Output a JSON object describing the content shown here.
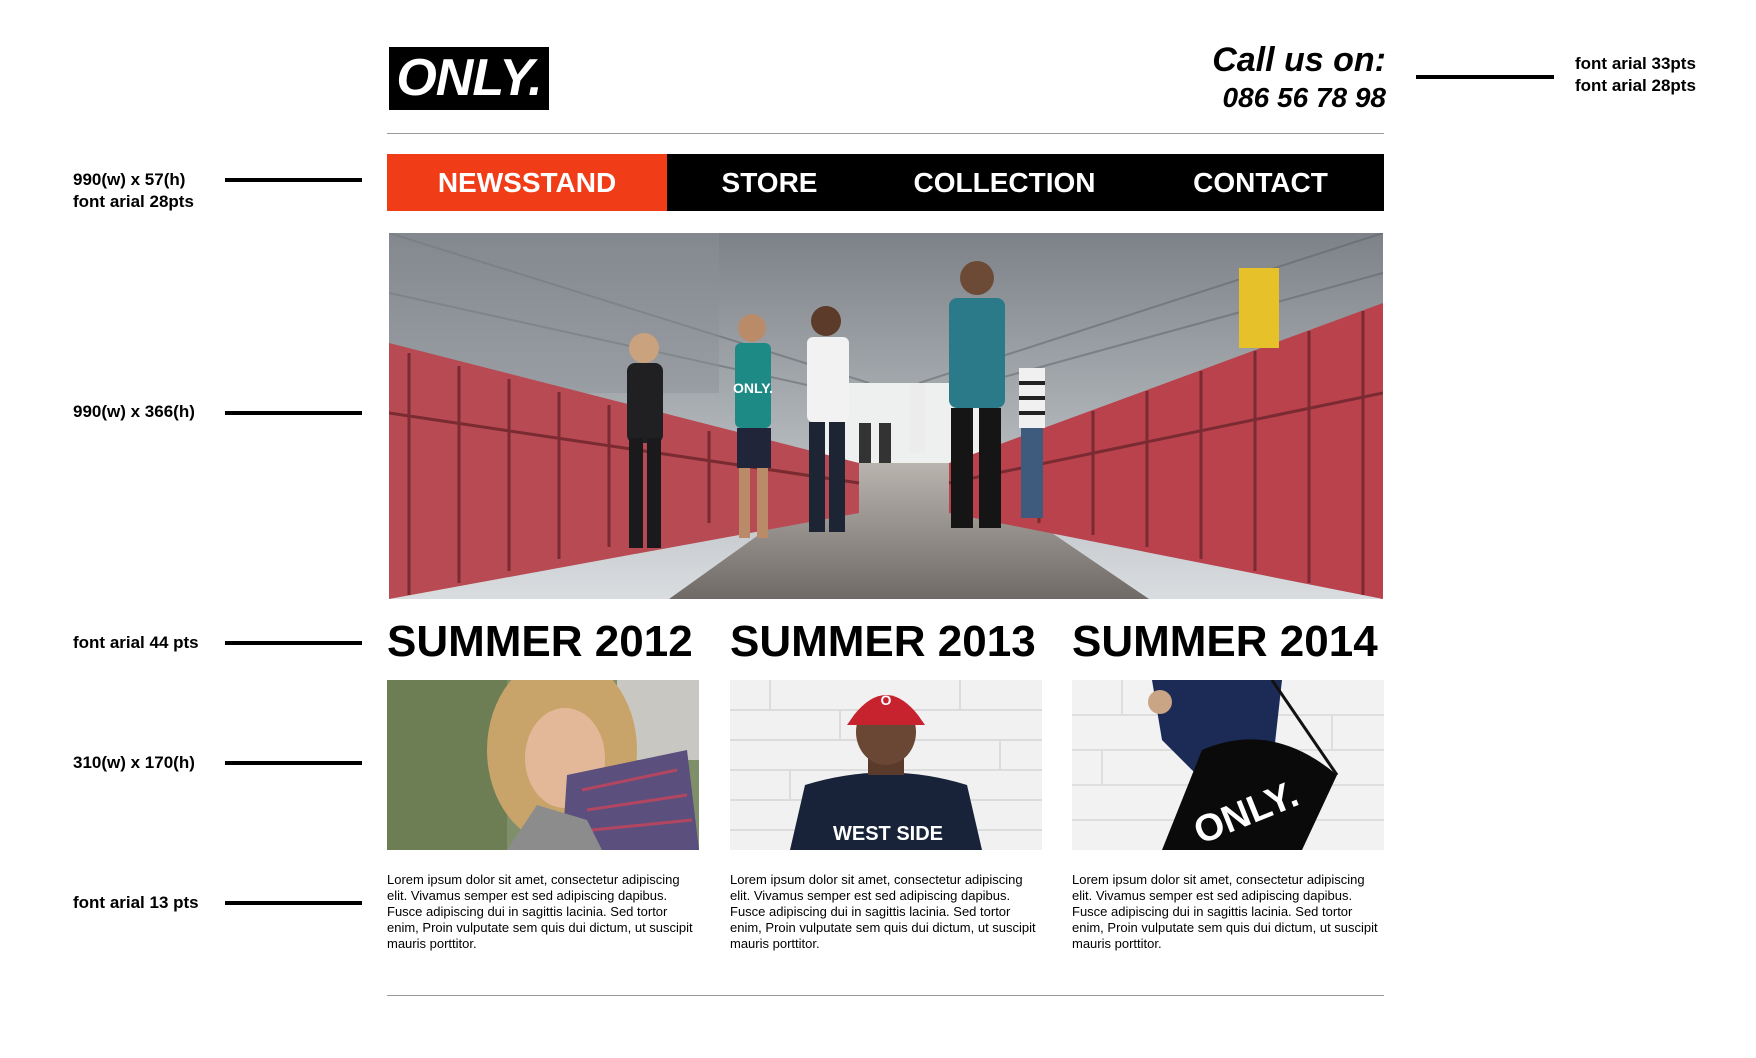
{
  "header": {
    "logo_text": "ONLY.",
    "call_label": "Call us on:",
    "phone": "086 56 78 98"
  },
  "nav": {
    "items": [
      {
        "label": "NEWSSTAND",
        "active": true
      },
      {
        "label": "STORE",
        "active": false
      },
      {
        "label": "COLLECTION",
        "active": false
      },
      {
        "label": "CONTACT",
        "active": false
      }
    ]
  },
  "annotations": {
    "nav_spec": "990(w) x 57(h)\nfont arial 28pts",
    "hero_spec": "990(w) x 366(h)",
    "heading_spec": "font arial 44 pts",
    "thumb_spec": "310(w) x 170(h)",
    "body_spec": "font arial 13 pts",
    "phone_spec": "font arial 33pts\nfont arial 28pts"
  },
  "columns": [
    {
      "title": "SUMMER 2012",
      "text": "Lorem ipsum dolor sit amet, consectetur adipiscing elit. Vivamus semper est sed adipiscing dapibus. Fusce adipiscing dui in sagittis lacinia. Sed tortor enim,  Proin vulputate sem quis dui dictum, ut suscipit mauris porttitor."
    },
    {
      "title": "SUMMER 2013",
      "text": "Lorem ipsum dolor sit amet, consectetur adipiscing elit. Vivamus semper est sed adipiscing dapibus. Fusce adipiscing dui in sagittis lacinia. Sed tortor enim,  Proin vulputate sem quis dui dictum, ut suscipit mauris porttitor."
    },
    {
      "title": "SUMMER 2014",
      "text": "Lorem ipsum dolor sit amet, consectetur adipiscing elit. Vivamus semper est sed adipiscing dapibus. Fusce adipiscing dui in sagittis lacinia. Sed tortor enim,  Proin vulputate sem quis dui dictum, ut suscipit mauris porttitor."
    }
  ],
  "images": {
    "hero_shirt_text": "ONLY.",
    "thumb2_shirt_text": "WEST SIDE",
    "thumb2_cap_text": "O",
    "thumb3_bag_text": "ONLY."
  },
  "colors": {
    "accent": "#f03c17",
    "nav_bg": "#000000",
    "rule": "#9a9a9a"
  }
}
